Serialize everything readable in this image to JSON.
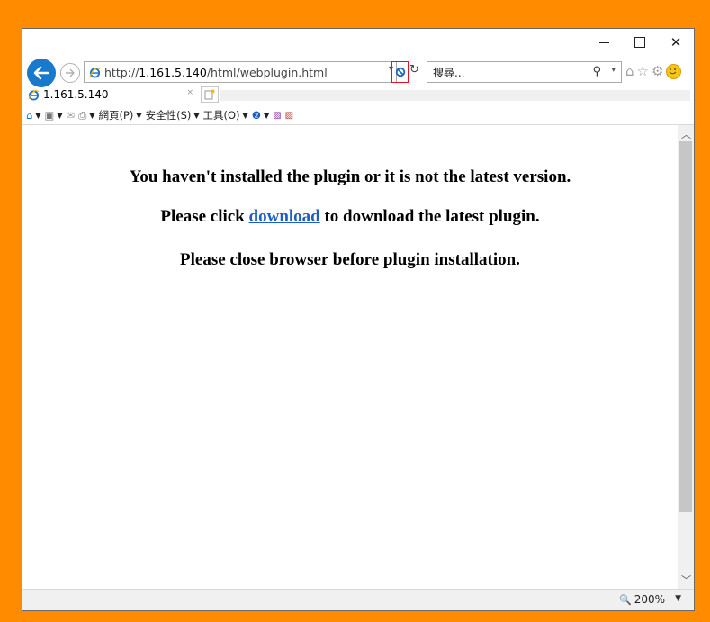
{
  "window": {
    "minimize_icon": "minimize-icon",
    "maximize_icon": "maximize-icon",
    "close_label": "✕"
  },
  "nav": {
    "url_prefix": "http://",
    "url_host": "1.161.5.140",
    "url_path": "/html/webplugin.html",
    "search_placeholder": "搜尋...",
    "icons": [
      "back-arrow-icon",
      "forward-arrow-icon",
      "ie-logo-icon",
      "blocked-content-icon",
      "refresh-icon",
      "search-icon",
      "home-icon",
      "favorites-star-icon",
      "settings-gear-icon",
      "smiley-feedback-icon"
    ]
  },
  "tab": {
    "title": "1.161.5.140",
    "close_label": "×"
  },
  "commandbar": {
    "page_menu": "網頁(P)",
    "safety_menu": "安全性(S)",
    "tools_menu": "工具(O)"
  },
  "content": {
    "line1": "You haven't installed the plugin or it is not the latest version.",
    "line2_before": "Please click ",
    "line2_link": "download",
    "line2_after": " to download the latest plugin.",
    "line3": "Please close browser before plugin installation."
  },
  "status": {
    "zoom": "200%"
  },
  "colors": {
    "frame": "#ff8c00",
    "back_button": "#1979ca",
    "link": "#1f5fc3",
    "block_highlight": "#e81123"
  }
}
